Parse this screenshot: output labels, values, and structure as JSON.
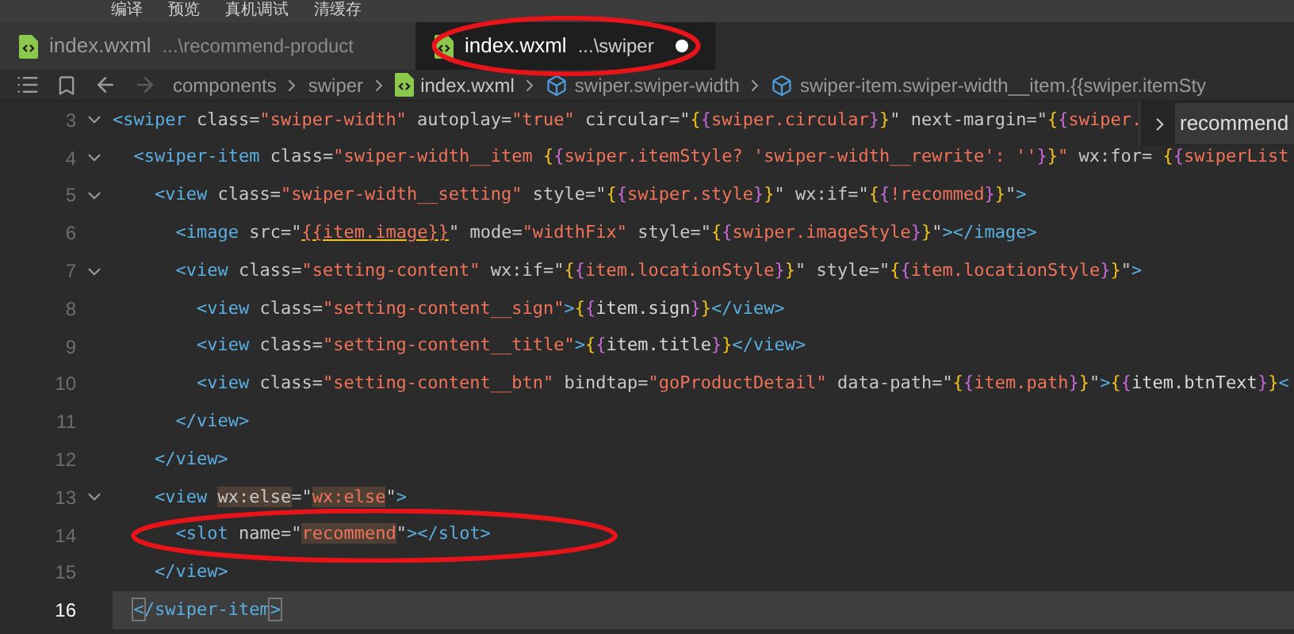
{
  "menu": [
    "编译",
    "预览",
    "真机调试",
    "清缓存"
  ],
  "tabs": [
    {
      "label": "index.wxml",
      "path": "...\\recommend-product",
      "selected": false,
      "modified": false,
      "circled": false
    },
    {
      "label": "index.wxml",
      "path": "...\\swiper",
      "selected": true,
      "modified": true,
      "circled": true
    }
  ],
  "breadcrumb": [
    {
      "kind": "folder",
      "label": "components"
    },
    {
      "kind": "folder",
      "label": "swiper"
    },
    {
      "kind": "file",
      "label": "index.wxml"
    },
    {
      "kind": "element",
      "label": "swiper.swiper-width"
    },
    {
      "kind": "element",
      "label": "swiper-item.swiper-width__item.{{swiper.itemSty"
    }
  ],
  "find_widget": {
    "value": "recommend"
  },
  "lines": [
    {
      "number": "3",
      "fold": true,
      "current": false,
      "circled": false,
      "tokens": [
        {
          "kind": "tag",
          "text": "<swiper"
        },
        {
          "kind": "plain",
          "text": " class="
        },
        {
          "kind": "string",
          "text": "\"swiper-width\""
        },
        {
          "kind": "plain",
          "text": " autoplay="
        },
        {
          "kind": "string",
          "text": "\"true\""
        },
        {
          "kind": "plain",
          "text": " circular=\""
        },
        {
          "kind": "brace",
          "text": "{"
        },
        {
          "kind": "brace2",
          "text": "{"
        },
        {
          "kind": "string",
          "text": "swiper.circular"
        },
        {
          "kind": "brace2",
          "text": "}"
        },
        {
          "kind": "brace",
          "text": "}"
        },
        {
          "kind": "plain",
          "text": "\" next-margin=\""
        },
        {
          "kind": "brace",
          "text": "{"
        },
        {
          "kind": "brace2",
          "text": "{"
        },
        {
          "kind": "string",
          "text": "swiper."
        }
      ]
    },
    {
      "number": "4",
      "fold": true,
      "current": false,
      "circled": false,
      "tokens": [
        {
          "kind": "tag",
          "text": "  <swiper-item"
        },
        {
          "kind": "plain",
          "text": " class="
        },
        {
          "kind": "string",
          "text": "\"swiper-width__item "
        },
        {
          "kind": "brace",
          "text": "{"
        },
        {
          "kind": "brace2",
          "text": "{"
        },
        {
          "kind": "string",
          "text": "swiper.itemStyle? 'swiper-width__rewrite': ''"
        },
        {
          "kind": "brace2",
          "text": "}"
        },
        {
          "kind": "brace",
          "text": "}"
        },
        {
          "kind": "string",
          "text": "\""
        },
        {
          "kind": "plain",
          "text": " wx:for= "
        },
        {
          "kind": "brace",
          "text": "{"
        },
        {
          "kind": "brace2",
          "text": "{"
        },
        {
          "kind": "string",
          "text": "swiperList"
        }
      ]
    },
    {
      "number": "5",
      "fold": true,
      "current": false,
      "circled": false,
      "tokens": [
        {
          "kind": "tag",
          "text": "    <view"
        },
        {
          "kind": "plain",
          "text": " class="
        },
        {
          "kind": "string",
          "text": "\"swiper-width__setting\""
        },
        {
          "kind": "plain",
          "text": " style=\""
        },
        {
          "kind": "brace",
          "text": "{"
        },
        {
          "kind": "brace2",
          "text": "{"
        },
        {
          "kind": "string",
          "text": "swiper.style"
        },
        {
          "kind": "brace2",
          "text": "}"
        },
        {
          "kind": "brace",
          "text": "}"
        },
        {
          "kind": "plain",
          "text": "\" wx:if=\""
        },
        {
          "kind": "brace",
          "text": "{"
        },
        {
          "kind": "brace2",
          "text": "{"
        },
        {
          "kind": "string",
          "text": "!recommed"
        },
        {
          "kind": "brace2",
          "text": "}"
        },
        {
          "kind": "brace",
          "text": "}"
        },
        {
          "kind": "plain",
          "text": "\""
        },
        {
          "kind": "tag",
          "text": ">"
        }
      ]
    },
    {
      "number": "6",
      "fold": false,
      "current": false,
      "circled": false,
      "tokens": [
        {
          "kind": "tag",
          "text": "      <image"
        },
        {
          "kind": "plain",
          "text": " src=\""
        },
        {
          "kind": "squiggle",
          "text": "{{item.image}}"
        },
        {
          "kind": "plain",
          "text": "\" mode="
        },
        {
          "kind": "string",
          "text": "\"widthFix\""
        },
        {
          "kind": "plain",
          "text": " style=\""
        },
        {
          "kind": "brace",
          "text": "{"
        },
        {
          "kind": "brace2",
          "text": "{"
        },
        {
          "kind": "string",
          "text": "swiper.imageStyle"
        },
        {
          "kind": "brace2",
          "text": "}"
        },
        {
          "kind": "brace",
          "text": "}"
        },
        {
          "kind": "plain",
          "text": "\""
        },
        {
          "kind": "tag",
          "text": "></image>"
        }
      ]
    },
    {
      "number": "7",
      "fold": true,
      "current": false,
      "circled": false,
      "tokens": [
        {
          "kind": "tag",
          "text": "      <view"
        },
        {
          "kind": "plain",
          "text": " class="
        },
        {
          "kind": "string",
          "text": "\"setting-content\""
        },
        {
          "kind": "plain",
          "text": " wx:if=\""
        },
        {
          "kind": "brace",
          "text": "{"
        },
        {
          "kind": "brace2",
          "text": "{"
        },
        {
          "kind": "string",
          "text": "item.locationStyle"
        },
        {
          "kind": "brace2",
          "text": "}"
        },
        {
          "kind": "brace",
          "text": "}"
        },
        {
          "kind": "plain",
          "text": "\" style=\""
        },
        {
          "kind": "brace",
          "text": "{"
        },
        {
          "kind": "brace2",
          "text": "{"
        },
        {
          "kind": "string",
          "text": "item.locationStyle"
        },
        {
          "kind": "brace2",
          "text": "}"
        },
        {
          "kind": "brace",
          "text": "}"
        },
        {
          "kind": "plain",
          "text": "\""
        },
        {
          "kind": "tag",
          "text": ">"
        }
      ]
    },
    {
      "number": "8",
      "fold": false,
      "current": false,
      "circled": false,
      "tokens": [
        {
          "kind": "tag",
          "text": "        <view"
        },
        {
          "kind": "plain",
          "text": " class="
        },
        {
          "kind": "string",
          "text": "\"setting-content__sign\""
        },
        {
          "kind": "tag",
          "text": ">"
        },
        {
          "kind": "brace",
          "text": "{"
        },
        {
          "kind": "brace2",
          "text": "{"
        },
        {
          "kind": "text",
          "text": "item.sign"
        },
        {
          "kind": "brace2",
          "text": "}"
        },
        {
          "kind": "brace",
          "text": "}"
        },
        {
          "kind": "tag",
          "text": "</view>"
        }
      ]
    },
    {
      "number": "9",
      "fold": false,
      "current": false,
      "circled": false,
      "tokens": [
        {
          "kind": "tag",
          "text": "        <view"
        },
        {
          "kind": "plain",
          "text": " class="
        },
        {
          "kind": "string",
          "text": "\"setting-content__title\""
        },
        {
          "kind": "tag",
          "text": ">"
        },
        {
          "kind": "brace",
          "text": "{"
        },
        {
          "kind": "brace2",
          "text": "{"
        },
        {
          "kind": "text",
          "text": "item.title"
        },
        {
          "kind": "brace2",
          "text": "}"
        },
        {
          "kind": "brace",
          "text": "}"
        },
        {
          "kind": "tag",
          "text": "</view>"
        }
      ]
    },
    {
      "number": "10",
      "fold": false,
      "current": false,
      "circled": false,
      "tokens": [
        {
          "kind": "tag",
          "text": "        <view"
        },
        {
          "kind": "plain",
          "text": " class="
        },
        {
          "kind": "string",
          "text": "\"setting-content__btn\""
        },
        {
          "kind": "plain",
          "text": " bindtap="
        },
        {
          "kind": "string",
          "text": "\"goProductDetail\""
        },
        {
          "kind": "plain",
          "text": " data-path=\""
        },
        {
          "kind": "brace",
          "text": "{"
        },
        {
          "kind": "brace2",
          "text": "{"
        },
        {
          "kind": "string",
          "text": "item.path"
        },
        {
          "kind": "brace2",
          "text": "}"
        },
        {
          "kind": "brace",
          "text": "}"
        },
        {
          "kind": "plain",
          "text": "\""
        },
        {
          "kind": "tag",
          "text": ">"
        },
        {
          "kind": "brace",
          "text": "{"
        },
        {
          "kind": "brace2",
          "text": "{"
        },
        {
          "kind": "text",
          "text": "item.btnText"
        },
        {
          "kind": "brace2",
          "text": "}"
        },
        {
          "kind": "brace",
          "text": "}"
        },
        {
          "kind": "tag",
          "text": "<"
        }
      ]
    },
    {
      "number": "11",
      "fold": false,
      "current": false,
      "circled": false,
      "tokens": [
        {
          "kind": "tag",
          "text": "      </view>"
        }
      ]
    },
    {
      "number": "12",
      "fold": false,
      "current": false,
      "circled": false,
      "tokens": [
        {
          "kind": "tag",
          "text": "    </view>"
        }
      ]
    },
    {
      "number": "13",
      "fold": true,
      "current": false,
      "circled": false,
      "tokens": [
        {
          "kind": "tag",
          "text": "    <view "
        },
        {
          "kind": "match",
          "text": "wx:else"
        },
        {
          "kind": "plain",
          "text": "=\""
        },
        {
          "kind": "matchstring",
          "text": "wx:else"
        },
        {
          "kind": "plain",
          "text": "\""
        },
        {
          "kind": "tag",
          "text": ">"
        }
      ]
    },
    {
      "number": "14",
      "fold": false,
      "current": false,
      "circled": true,
      "tokens": [
        {
          "kind": "tag",
          "text": "      <slot"
        },
        {
          "kind": "plain",
          "text": " name=\""
        },
        {
          "kind": "matchstring",
          "text": "recommend"
        },
        {
          "kind": "plain",
          "text": "\""
        },
        {
          "kind": "tag",
          "text": "></slot>"
        }
      ]
    },
    {
      "number": "15",
      "fold": false,
      "current": false,
      "circled": false,
      "tokens": [
        {
          "kind": "tag",
          "text": "    </view>"
        }
      ]
    },
    {
      "number": "16",
      "fold": false,
      "current": true,
      "circled": false,
      "tokens": [
        {
          "kind": "bracket",
          "text": "  <"
        },
        {
          "kind": "tag",
          "text": "/swiper-item"
        },
        {
          "kind": "bracket",
          "text": ">"
        }
      ]
    }
  ]
}
